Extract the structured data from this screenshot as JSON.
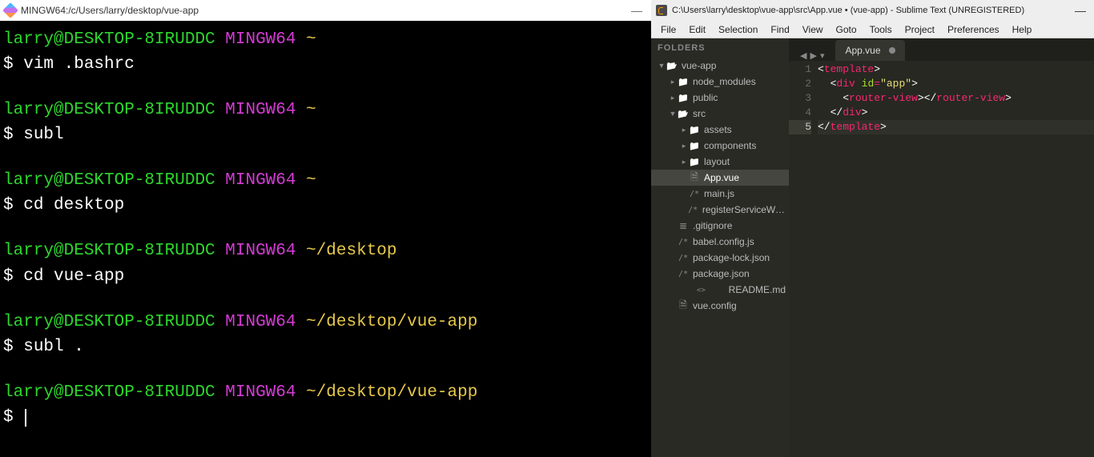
{
  "terminal": {
    "title": "MINGW64:/c/Users/larry/desktop/vue-app",
    "blocks": [
      {
        "user": "larry@DESKTOP-8IRUDDC",
        "host": "MINGW64",
        "path": "~",
        "cmd": "vim .bashrc"
      },
      {
        "user": "larry@DESKTOP-8IRUDDC",
        "host": "MINGW64",
        "path": "~",
        "cmd": "subl"
      },
      {
        "user": "larry@DESKTOP-8IRUDDC",
        "host": "MINGW64",
        "path": "~",
        "cmd": "cd desktop"
      },
      {
        "user": "larry@DESKTOP-8IRUDDC",
        "host": "MINGW64",
        "path": "~/desktop",
        "cmd": "cd vue-app"
      },
      {
        "user": "larry@DESKTOP-8IRUDDC",
        "host": "MINGW64",
        "path": "~/desktop/vue-app",
        "cmd": "subl ."
      },
      {
        "user": "larry@DESKTOP-8IRUDDC",
        "host": "MINGW64",
        "path": "~/desktop/vue-app",
        "cmd": ""
      }
    ],
    "prompt": "$"
  },
  "editor": {
    "title": "C:\\Users\\larry\\desktop\\vue-app\\src\\App.vue • (vue-app) - Sublime Text (UNREGISTERED)",
    "menu": [
      "File",
      "Edit",
      "Selection",
      "Find",
      "View",
      "Goto",
      "Tools",
      "Project",
      "Preferences",
      "Help"
    ],
    "folders_label": "FOLDERS",
    "tree": [
      {
        "depth": 0,
        "arrow": "▼",
        "icon": "folder-open",
        "label": "vue-app"
      },
      {
        "depth": 1,
        "arrow": "▸",
        "icon": "folder",
        "label": "node_modules"
      },
      {
        "depth": 1,
        "arrow": "▸",
        "icon": "folder",
        "label": "public"
      },
      {
        "depth": 1,
        "arrow": "▼",
        "icon": "folder-open",
        "label": "src"
      },
      {
        "depth": 2,
        "arrow": "▸",
        "icon": "folder",
        "label": "assets"
      },
      {
        "depth": 2,
        "arrow": "▸",
        "icon": "folder",
        "label": "components"
      },
      {
        "depth": 2,
        "arrow": "▸",
        "icon": "folder",
        "label": "layout"
      },
      {
        "depth": 2,
        "arrow": "",
        "icon": "file",
        "label": "App.vue",
        "selected": true
      },
      {
        "depth": 2,
        "arrow": "",
        "icon": "js",
        "label": "main.js"
      },
      {
        "depth": 2,
        "arrow": "",
        "icon": "js",
        "label": "registerServiceWork"
      },
      {
        "depth": 1,
        "arrow": "",
        "icon": "lines",
        "label": ".gitignore"
      },
      {
        "depth": 1,
        "arrow": "",
        "icon": "js",
        "label": "babel.config.js"
      },
      {
        "depth": 1,
        "arrow": "",
        "icon": "js",
        "label": "package-lock.json"
      },
      {
        "depth": 1,
        "arrow": "",
        "icon": "js",
        "label": "package.json"
      },
      {
        "depth": 1,
        "arrow": "",
        "icon": "code",
        "label": "README.md"
      },
      {
        "depth": 1,
        "arrow": "",
        "icon": "file",
        "label": "vue.config"
      }
    ],
    "tab": {
      "label": "App.vue",
      "dirty": true
    },
    "code": {
      "lines": [
        [
          {
            "t": "<",
            "c": "tag-angle"
          },
          {
            "t": "template",
            "c": "tag-name"
          },
          {
            "t": ">",
            "c": "tag-angle"
          }
        ],
        [
          {
            "t": "  ",
            "c": ""
          },
          {
            "t": "<",
            "c": "tag-angle"
          },
          {
            "t": "div",
            "c": "tag-name"
          },
          {
            "t": " ",
            "c": ""
          },
          {
            "t": "id",
            "c": "attr-name"
          },
          {
            "t": "=",
            "c": "attr-eq"
          },
          {
            "t": "\"app\"",
            "c": "attr-val"
          },
          {
            "t": ">",
            "c": "tag-angle"
          }
        ],
        [
          {
            "t": "    ",
            "c": ""
          },
          {
            "t": "<",
            "c": "tag-angle"
          },
          {
            "t": "router-view",
            "c": "tag-name"
          },
          {
            "t": ">",
            "c": "tag-angle"
          },
          {
            "t": "</",
            "c": "tag-angle"
          },
          {
            "t": "router-view",
            "c": "tag-name"
          },
          {
            "t": ">",
            "c": "tag-angle"
          }
        ],
        [
          {
            "t": "  ",
            "c": ""
          },
          {
            "t": "</",
            "c": "tag-angle"
          },
          {
            "t": "div",
            "c": "tag-name"
          },
          {
            "t": ">",
            "c": "tag-angle"
          }
        ],
        [
          {
            "t": "</",
            "c": "tag-angle"
          },
          {
            "t": "template",
            "c": "tag-name"
          },
          {
            "t": ">",
            "c": "tag-angle"
          }
        ]
      ],
      "active_line_index": 4
    }
  }
}
